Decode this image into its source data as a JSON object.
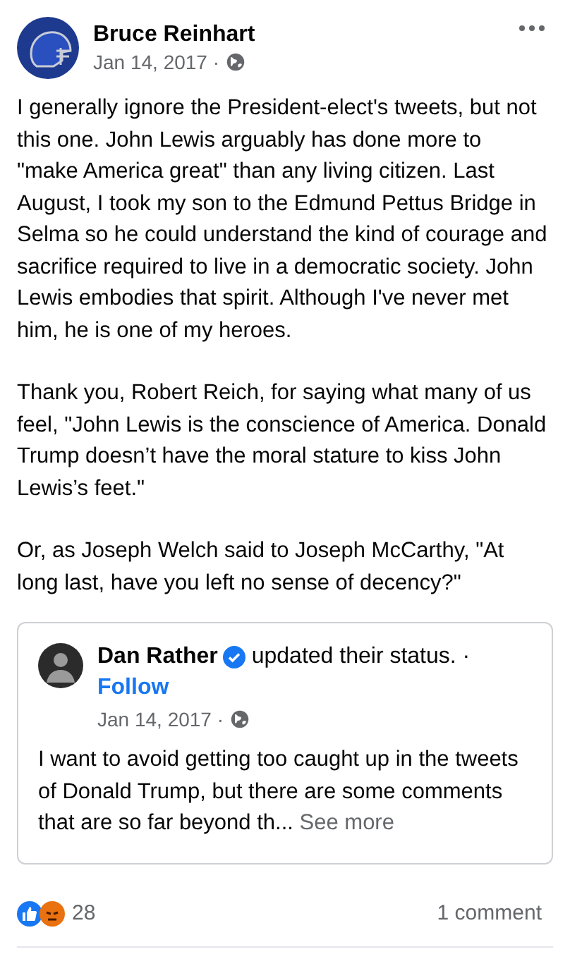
{
  "post": {
    "author": "Bruce Reinhart",
    "date": "Jan 14, 2017 ·",
    "paragraphs": [
      "I generally ignore the President-elect's tweets, but not this one. John Lewis arguably has done more to \"make America great\" than any living citizen. Last August, I took my son to the Edmund Pettus Bridge in Selma so he could understand the kind of courage and sacrifice required to live in a democratic society.  John Lewis embodies that spirit. Although I've never met him, he is one of my heroes.",
      "Thank you, Robert Reich, for saying what many of us feel, \"John Lewis is the conscience of America. Donald Trump doesn’t have the moral stature to kiss John Lewis’s feet.\"",
      "Or, as Joseph Welch said to Joseph McCarthy, \"At long last, have you left no sense of decency?\""
    ]
  },
  "shared": {
    "author": "Dan Rather",
    "verified": true,
    "action": "updated their status. ·",
    "follow": "Follow",
    "date": "Jan 14, 2017 ·",
    "text": "I want to avoid getting too caught up in the tweets of Donald Trump, but there are some comments that are so far beyond th...",
    "see_more": "See more"
  },
  "footer": {
    "reaction_count": "28",
    "comments": "1 comment"
  }
}
